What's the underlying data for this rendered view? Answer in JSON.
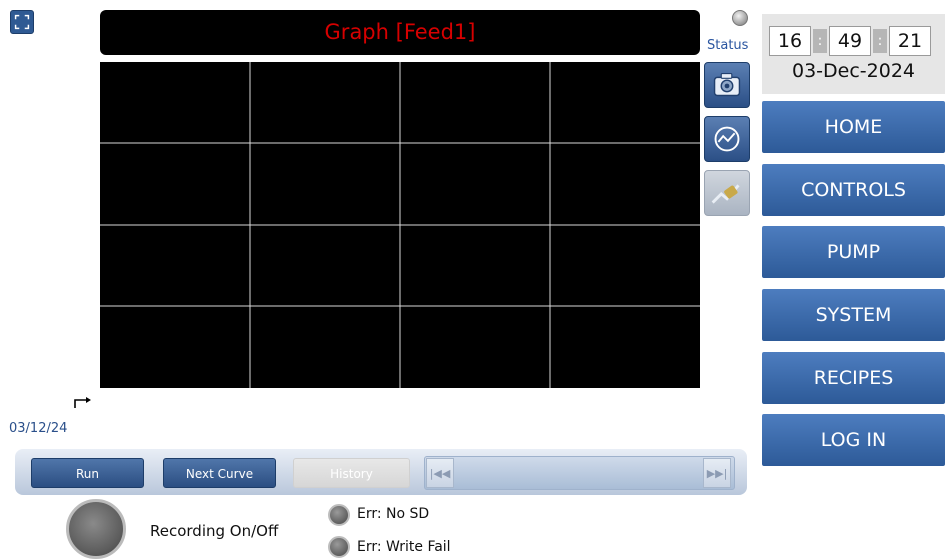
{
  "graph": {
    "title": "Graph [Feed1]",
    "start_date": "03/12/24"
  },
  "status": {
    "label": "Status"
  },
  "clock": {
    "hours": "16",
    "minutes": "49",
    "seconds": "21",
    "separator": ":",
    "date": "03-Dec-2024"
  },
  "nav": {
    "items": [
      {
        "label": "HOME"
      },
      {
        "label": "CONTROLS"
      },
      {
        "label": "PUMP"
      },
      {
        "label": "SYSTEM"
      },
      {
        "label": "RECIPES"
      },
      {
        "label": "LOG IN"
      }
    ]
  },
  "toolbar": {
    "run_label": "Run",
    "next_label": "Next Curve",
    "history_label": "History",
    "first_glyph": "|◀◀",
    "last_glyph": "▶▶|"
  },
  "recording": {
    "label": "Recording On/Off"
  },
  "errors": {
    "no_sd": "Err: No SD",
    "write_fail": "Err: Write Fail"
  },
  "icons": {
    "fullscreen": "fullscreen-icon",
    "camera": "camera-icon",
    "graph": "graph-icon",
    "export": "export-icon",
    "axis_marker": "axis-marker-icon"
  },
  "colors": {
    "title_text": "#d60000",
    "nav_blue": "#3b6aad",
    "graph_bg": "#000000"
  }
}
